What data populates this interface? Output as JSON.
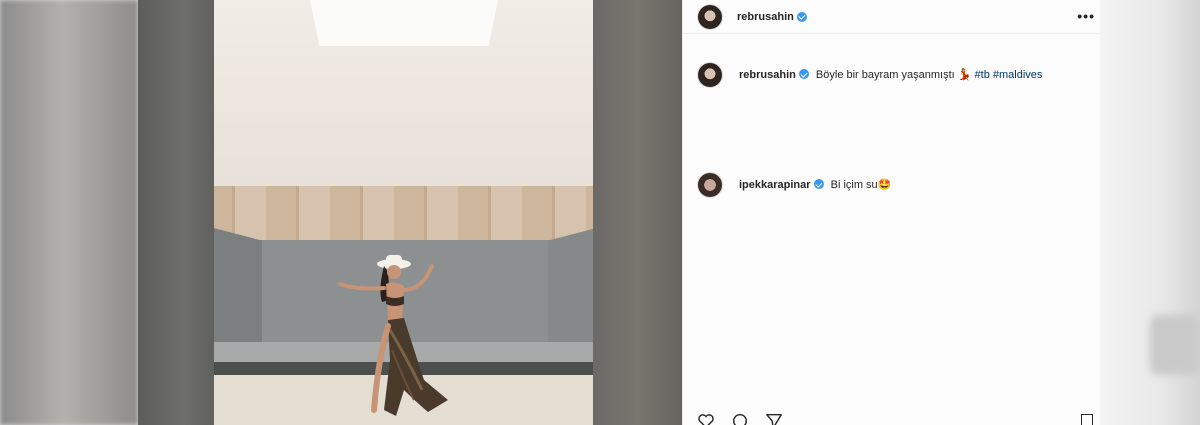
{
  "post": {
    "username": "rebrusahin",
    "caption_text": "Böyle bir bayram yaşanmıştı",
    "caption_emoji": "💃",
    "hashtags": [
      "#tb",
      "#maldives"
    ],
    "more_icon": "•••"
  },
  "comments": [
    {
      "username": "ipekkarapinar",
      "text": "Bi içim su",
      "emoji": "🤩"
    }
  ],
  "icons": {
    "next": "chevron-right-icon",
    "like": "heart-icon",
    "comment": "comment-icon",
    "share": "paper-plane-icon",
    "save": "bookmark-icon"
  },
  "colors": {
    "verified": "#3897f0",
    "hashtag": "#00376b",
    "text": "#262626"
  }
}
